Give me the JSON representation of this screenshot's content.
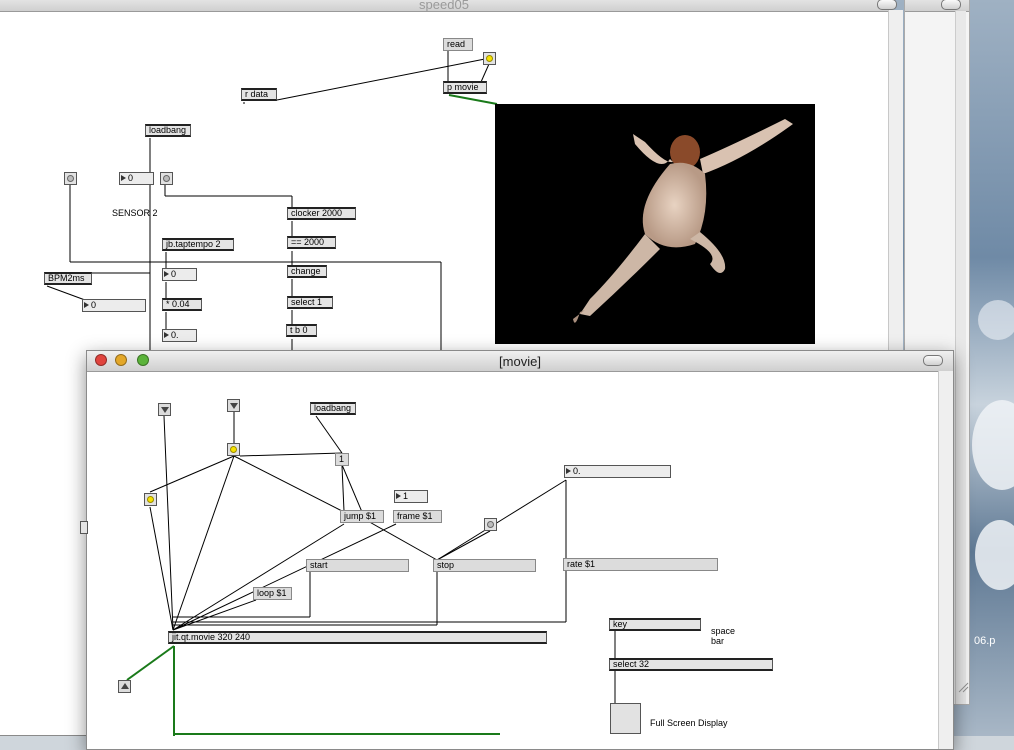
{
  "back_window": {
    "title": "speed05",
    "objects": {
      "read": "read",
      "p_movie": "p movie",
      "r_data": "r data",
      "loadbang": "loadbang",
      "num_zero_a": "0",
      "sensor_label": "SENSOR 2",
      "clocker": "clocker 2000",
      "eq2000": "== 2000",
      "taptempo": "jb.taptempo 2",
      "bpm2ms": "BPM2ms",
      "num_zero_b": "0",
      "change": "change",
      "num_zero_c": "0",
      "mult": "* 0.04",
      "select1": "select 1",
      "num_float": "0.",
      "tb0": "t b 0"
    }
  },
  "movie_window": {
    "title": "[movie]",
    "objects": {
      "loadbang": "loadbang",
      "one_msg": "1",
      "num_one": "1",
      "num_float": "0.",
      "jump": "jump $1",
      "frame": "frame $1",
      "start": "start",
      "stop": "stop",
      "rate": "rate $1",
      "loop": "loop $1",
      "jit_movie": "jit.qt.movie 320 240",
      "key": "key",
      "select32": "select 32",
      "space_bar": "space\nbar",
      "fullscreen": "Full Screen Display"
    }
  },
  "desktop": {
    "file_label": "06.p"
  },
  "colors": {
    "bang_on": "#f6e200",
    "patch_cord_signal": "#1a7a1a",
    "patch_cord": "#000000"
  }
}
